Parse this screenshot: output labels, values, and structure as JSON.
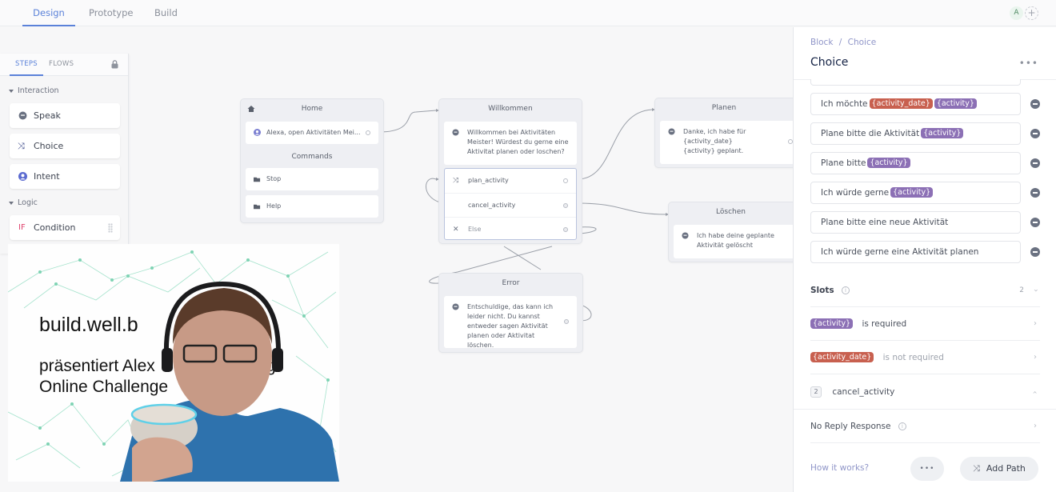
{
  "topbar": {
    "tabs": [
      {
        "label": "Design",
        "active": true
      },
      {
        "label": "Prototype",
        "active": false
      },
      {
        "label": "Build",
        "active": false
      }
    ],
    "avatar_initial": "A",
    "add_collaborator_icon": "plus-icon"
  },
  "steps_panel": {
    "tabs": [
      {
        "label": "STEPS",
        "active": true
      },
      {
        "label": "FLOWS",
        "active": false
      }
    ],
    "lock_icon": "lock-icon",
    "sections": [
      {
        "label": "Interaction",
        "items": [
          {
            "label": "Speak",
            "icon": "speech-bubble-icon"
          },
          {
            "label": "Choice",
            "icon": "choice-split-icon"
          },
          {
            "label": "Intent",
            "icon": "user-circle-icon"
          }
        ]
      },
      {
        "label": "Logic",
        "items": [
          {
            "label": "Condition",
            "icon": "if-icon",
            "icon_text": "IF"
          }
        ]
      }
    ]
  },
  "canvas": {
    "blocks": {
      "home": {
        "title": "Home",
        "intent_text": "Alexa, open Aktivitäten Mei...",
        "commands_label": "Commands",
        "commands": [
          "Stop",
          "Help"
        ]
      },
      "willkommen": {
        "title": "Willkommen",
        "speak_text": "Willkommen bei Aktivitäten Meister! Würdest du gerne eine Aktivitat planen oder loschen?",
        "choices": [
          "plan_activity",
          "cancel_activity",
          "Else"
        ]
      },
      "planen": {
        "title": "Planen",
        "speak_text": "Danke, ich habe für {activity_date} {activity} geplant."
      },
      "loeschen": {
        "title": "Löschen",
        "speak_text": "Ich habe deine geplante Aktivität gelöscht"
      },
      "error": {
        "title": "Error",
        "speak_text": "Entschuldige, das kann ich leider nicht. Du kannst entweder sagen Aktivität planen oder Aktivitat löschen."
      }
    }
  },
  "right_panel": {
    "breadcrumb": [
      "Block",
      "Choice"
    ],
    "breadcrumb_sep": "/",
    "title": "Choice",
    "more_label": "•••",
    "utterances": [
      {
        "parts": [
          {
            "text": "Ich möchte"
          },
          {
            "slot": "{activity_date}",
            "color": "red"
          },
          {
            "slot": "{activity}",
            "color": "purple"
          }
        ]
      },
      {
        "parts": [
          {
            "text": "Plane bitte die Aktivität"
          },
          {
            "slot": "{activity}",
            "color": "purple"
          }
        ]
      },
      {
        "parts": [
          {
            "text": "Plane bitte"
          },
          {
            "slot": "{activity}",
            "color": "purple"
          }
        ]
      },
      {
        "parts": [
          {
            "text": "Ich würde gerne"
          },
          {
            "slot": "{activity}",
            "color": "purple"
          }
        ]
      },
      {
        "parts": [
          {
            "text": "Plane bitte eine neue Aktivität"
          }
        ]
      },
      {
        "parts": [
          {
            "text": "Ich würde gerne eine Aktivität planen"
          }
        ]
      }
    ],
    "slots": {
      "label": "Slots",
      "count": "2",
      "items": [
        {
          "slot": "{activity}",
          "color": "purple",
          "status": "is required"
        },
        {
          "slot": "{activity_date}",
          "color": "red",
          "status": "is not required"
        }
      ]
    },
    "path": {
      "number": "2",
      "name": "cancel_activity"
    },
    "no_reply": "No Reply Response",
    "footer": {
      "how_it_works": "How it works?",
      "more_label": "•••",
      "add_path": "Add Path"
    }
  },
  "webcam_overlay": {
    "title": "build.well.b",
    "subtitle_line1": "präsentiert Alex",
    "subtitle_line1_end": "eing",
    "subtitle_line2": "Online Challenge"
  },
  "colors": {
    "accent": "#5b82d9",
    "slot_purple": "#8c70b5",
    "slot_red": "#c8604f",
    "condition_pink": "#e0456f"
  }
}
